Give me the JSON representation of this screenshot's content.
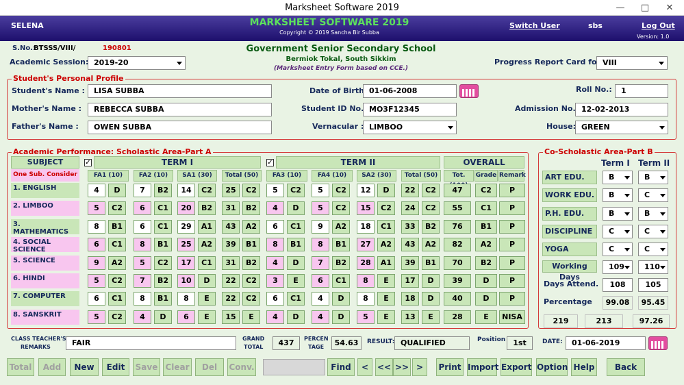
{
  "window": {
    "title": "Marksheet Software 2019"
  },
  "banner": {
    "user": "SELENA",
    "title": "MARKSHEET SOFTWARE 2019",
    "copyright": "Copyright © 2019 Sancha Bir Subba",
    "switch_user": "Switch User",
    "username": "sbs",
    "logout": "Log Out",
    "version": "Version: 1.0"
  },
  "school": {
    "name": "Government Senior Secondary School",
    "address": "Bermiok Tokal, South Sikkim",
    "note": "(Marksheet Entry Form  based on CCE.)"
  },
  "header": {
    "sno_label": "S.No.:",
    "sno_prefix": "BTSSS/VIII/",
    "sno_value": "190801",
    "session_label": "Academic Session:",
    "session_value": "2019-20",
    "prc_label": "Progress Report Card for",
    "prc_value": "VIII"
  },
  "profile": {
    "group_title": "Student's Personal Profile",
    "name_label": "Student's Name :",
    "name": "LISA SUBBA",
    "mother_label": "Mother's Name  :",
    "mother": "REBECCA SUBBA",
    "father_label": "Father's Name   :",
    "father": "OWEN SUBBA",
    "dob_label": "Date of Birth:",
    "dob": "01-06-2008",
    "sid_label": "Student ID No.:",
    "sid": "MO3F12345",
    "vern_label": "Vernacular  :",
    "vern": "LIMBOO",
    "roll_label": "Roll No.:",
    "roll": "1",
    "adm_label": "Admission No.:",
    "adm": "12-02-2013",
    "house_label": "House:",
    "house": "GREEN"
  },
  "academic": {
    "group_title": "Academic Performance: Scholastic Area-Part A",
    "subject_hdr": "SUBJECT",
    "one_sub": "One Sub. Consider",
    "term1": "TERM I",
    "term2": "TERM II",
    "overall": "OVERALL",
    "check": "✓",
    "cols": [
      "FA1 (10)",
      "FA2 (10)",
      "SA1 (30)",
      "Total (50)",
      "FA3 (10)",
      "FA4 (10)",
      "SA2 (30)",
      "Total (50)",
      "Tot.(100)",
      "Grade",
      "Remark"
    ],
    "rows": [
      {
        "subject": "1. ENGLISH",
        "v": [
          "4",
          "D",
          "7",
          "B2",
          "14",
          "C2",
          "25",
          "C2",
          "5",
          "C2",
          "5",
          "C2",
          "12",
          "D",
          "22",
          "C2",
          "47",
          "C2",
          "P"
        ]
      },
      {
        "subject": "2. LIMBOO",
        "v": [
          "5",
          "C2",
          "6",
          "C1",
          "20",
          "B2",
          "31",
          "B2",
          "4",
          "D",
          "5",
          "C2",
          "15",
          "C2",
          "24",
          "C2",
          "55",
          "C1",
          "P"
        ]
      },
      {
        "subject": "3. MATHEMATICS",
        "v": [
          "8",
          "B1",
          "6",
          "C1",
          "29",
          "A1",
          "43",
          "A2",
          "6",
          "C1",
          "9",
          "A2",
          "18",
          "C1",
          "33",
          "B2",
          "76",
          "B1",
          "P"
        ]
      },
      {
        "subject": "4. SOCIAL SCIENCE",
        "v": [
          "6",
          "C1",
          "8",
          "B1",
          "25",
          "A2",
          "39",
          "B1",
          "8",
          "B1",
          "8",
          "B1",
          "27",
          "A2",
          "43",
          "A2",
          "82",
          "A2",
          "P"
        ]
      },
      {
        "subject": "5. SCIENCE",
        "v": [
          "9",
          "A2",
          "5",
          "C2",
          "17",
          "C1",
          "31",
          "B2",
          "4",
          "D",
          "7",
          "B2",
          "28",
          "A1",
          "39",
          "B1",
          "70",
          "B2",
          "P"
        ]
      },
      {
        "subject": "6. HINDI",
        "v": [
          "5",
          "C2",
          "7",
          "B2",
          "10",
          "D",
          "22",
          "C2",
          "3",
          "E",
          "6",
          "C1",
          "8",
          "E",
          "17",
          "D",
          "39",
          "D",
          "P"
        ]
      },
      {
        "subject": "7. COMPUTER",
        "v": [
          "6",
          "C1",
          "8",
          "B1",
          "8",
          "E",
          "22",
          "C2",
          "6",
          "C1",
          "4",
          "D",
          "8",
          "E",
          "18",
          "D",
          "40",
          "D",
          "P"
        ]
      },
      {
        "subject": "8. SANSKRIT",
        "v": [
          "5",
          "C2",
          "4",
          "D",
          "6",
          "E",
          "15",
          "E",
          "4",
          "D",
          "4",
          "D",
          "5",
          "E",
          "13",
          "E",
          "28",
          "E",
          "NISA"
        ]
      }
    ]
  },
  "coscholastic": {
    "group_title": "Co-Scholastic Area-Part B",
    "term1": "Term I",
    "term2": "Term II",
    "items": [
      {
        "label": "ART EDU.",
        "t1": "B",
        "t2": "B"
      },
      {
        "label": "WORK  EDU.",
        "t1": "B",
        "t2": "C"
      },
      {
        "label": "P.H. EDU.",
        "t1": "B",
        "t2": "B"
      },
      {
        "label": "DISCIPLINE",
        "t1": "C",
        "t2": "C"
      },
      {
        "label": "YOGA",
        "t1": "C",
        "t2": "C"
      }
    ],
    "working_days_label": "Working Days",
    "wd1": "109",
    "wd2": "110",
    "days_attend_label": "Days Attend.",
    "da1": "108",
    "da2": "105",
    "percentage_label": "Percentage",
    "pc1": "99.08",
    "pc2": "95.45",
    "sum1": "219",
    "sum2": "213",
    "sum3": "97.26"
  },
  "footer": {
    "remarks_label1": "CLASS TEACHER'S",
    "remarks_label2": "REMARKS",
    "remarks": "FAIR",
    "grand_label1": "GRAND",
    "grand_label2": "TOTAL",
    "grand": "437",
    "percent_label1": "PERCEN",
    "percent_label2": "TAGE",
    "percent": "54.63",
    "result_label": "RESULT:",
    "result": "QUALIFIED",
    "position_label": "Position",
    "position": "1st",
    "date_label": "DATE:",
    "date": "01-06-2019"
  },
  "buttons": {
    "total": "Total",
    "add": "Add",
    "new": "New",
    "edit": "Edit",
    "save": "Save",
    "clear": "Clear",
    "del": "Del",
    "conv": "Conv.",
    "find": "Find",
    "prev": "<",
    "first": "<<",
    "last": ">>",
    "next": ">",
    "print": "Print",
    "import": "Import",
    "export": "Export",
    "option": "Option",
    "help": "Help",
    "back": "Back"
  }
}
